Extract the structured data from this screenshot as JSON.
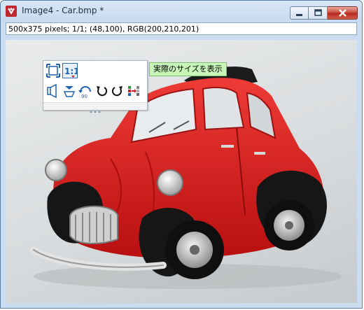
{
  "window": {
    "title": "Image4 - Car.bmp *",
    "status_text": "500x375 pixels; 1/1; (48,100), RGB(200,210,201)"
  },
  "toolbar": {
    "buttons": [
      {
        "icon": "fit-to-window-icon"
      },
      {
        "icon": "actual-size-icon",
        "active": true
      },
      {
        "icon": "flip-horizontal-icon"
      },
      {
        "icon": "flip-vertical-icon"
      },
      {
        "icon": "rotate-180-icon"
      },
      {
        "icon": "rotate-left-icon"
      },
      {
        "icon": "rotate-right-icon"
      },
      {
        "icon": "image-settings-icon"
      }
    ]
  },
  "tooltip": {
    "text": "実際のサイズを表示"
  },
  "colors": {
    "titlebar": "#c9dcf0",
    "car_body": "#d51a1a",
    "tooltip_bg": "#c8f5b8",
    "close_button": "#c8463a"
  }
}
